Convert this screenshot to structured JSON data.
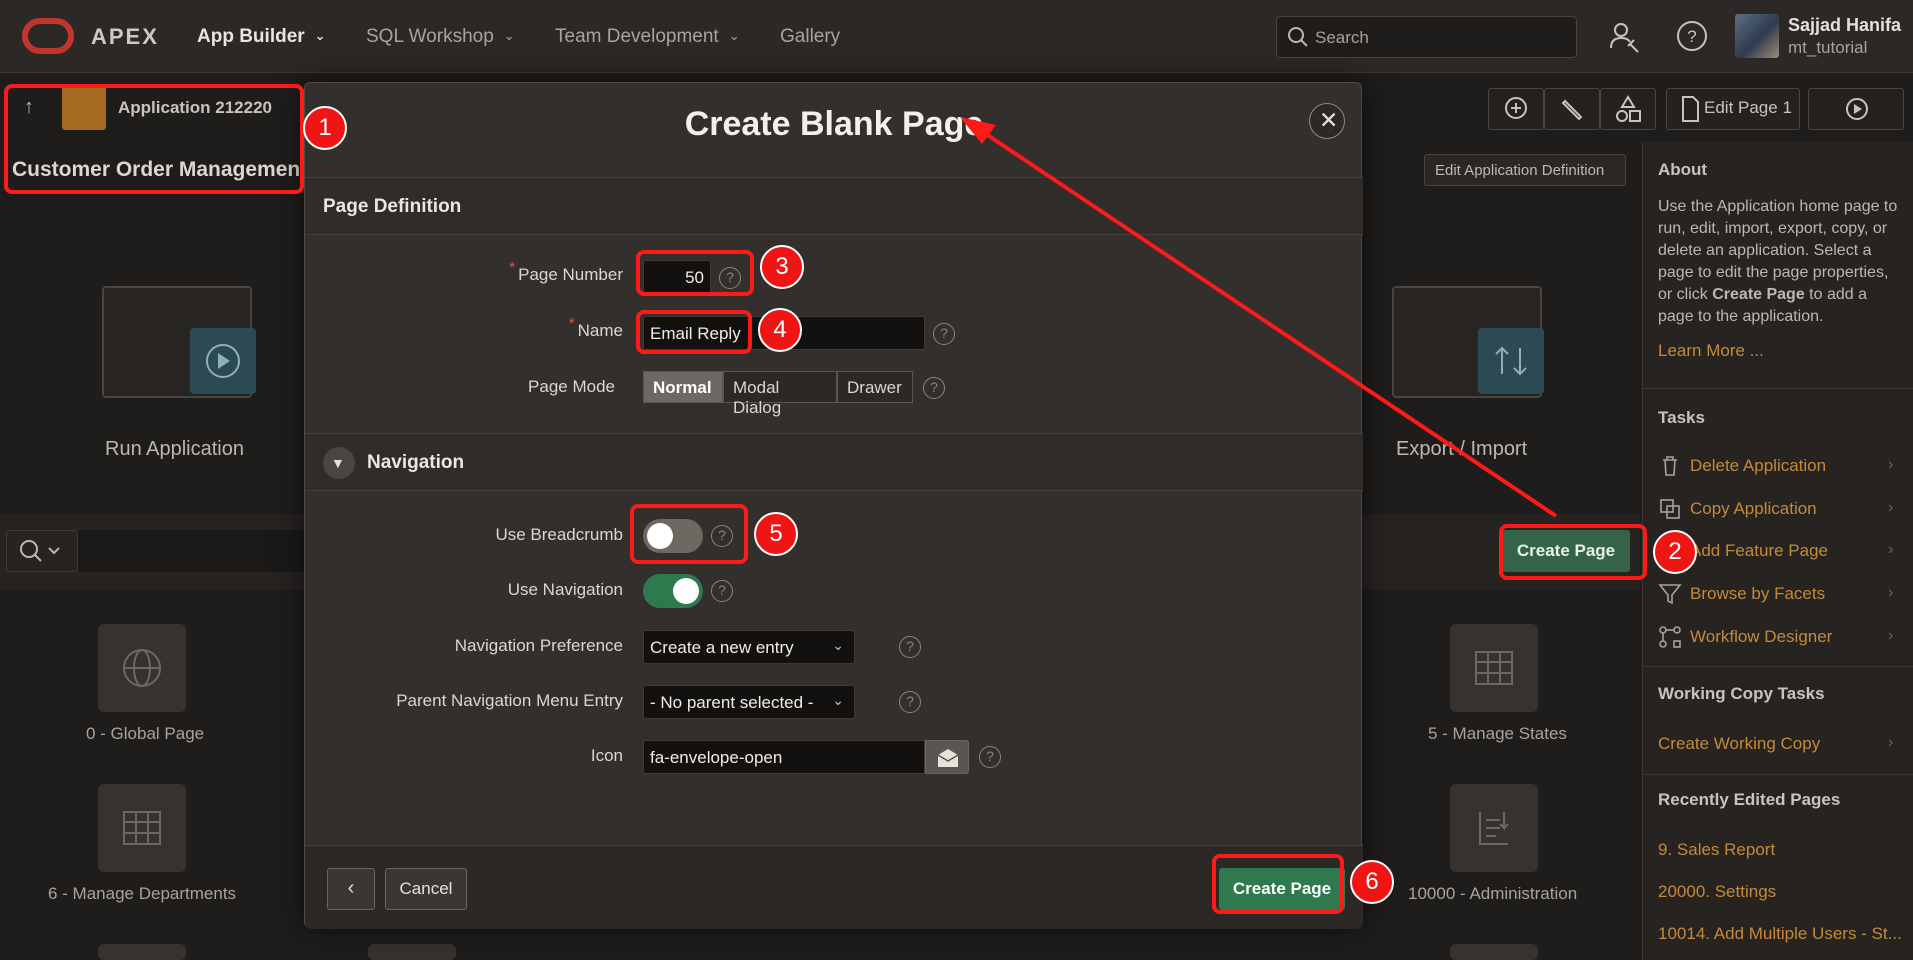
{
  "topnav": {
    "brand": "APEX",
    "items": [
      {
        "label": "App Builder"
      },
      {
        "label": "SQL Workshop"
      },
      {
        "label": "Team Development"
      },
      {
        "label": "Gallery"
      }
    ],
    "search_placeholder": "Search",
    "user_name": "Sajjad Hanifa",
    "user_login": "mt_tutorial"
  },
  "app": {
    "name": "Application 212220",
    "title": "Customer Order Management"
  },
  "toolbar": {
    "edit_page": "Edit Page 1",
    "edit_app_def": "Edit Application Definition"
  },
  "bg": {
    "run_app": "Run Application",
    "export_import": "Export / Import",
    "create_page": "Create Page",
    "pages": [
      {
        "label": "0 - Global Page"
      },
      {
        "label": "5 - Manage States"
      },
      {
        "label": "6 - Manage Departments"
      },
      {
        "label": "10000 - Administration"
      }
    ]
  },
  "sidebar": {
    "about_title": "About",
    "about_text_a": "Use the Application home page to run, edit, import, export, copy, or delete an application. Select a page to edit the page properties, or click ",
    "about_text_b": "Create Page",
    "about_text_c": " to add a page to the application.",
    "learn_more": "Learn More ...",
    "tasks_title": "Tasks",
    "tasks": [
      {
        "label": "Delete Application",
        "icon": "trash-icon"
      },
      {
        "label": "Copy Application",
        "icon": "copy-icon"
      },
      {
        "label": "Add Feature Page",
        "icon": "feature-icon"
      },
      {
        "label": "Browse by Facets",
        "icon": "filter-icon"
      },
      {
        "label": "Workflow Designer",
        "icon": "workflow-icon"
      }
    ],
    "working_copy_title": "Working Copy Tasks",
    "create_working_copy": "Create Working Copy",
    "recent_title": "Recently Edited Pages",
    "recent": [
      {
        "label": "9. Sales Report"
      },
      {
        "label": "20000. Settings"
      },
      {
        "label": "10014. Add Multiple Users - St..."
      }
    ]
  },
  "modal": {
    "title": "Create Blank Page",
    "section_page_def": "Page Definition",
    "page_number_label": "Page Number",
    "page_number_value": "50",
    "name_label": "Name",
    "name_value": "Email Reply",
    "page_mode_label": "Page Mode",
    "page_modes": [
      "Normal",
      "Modal Dialog",
      "Drawer"
    ],
    "page_mode_selected": "Normal",
    "section_navigation": "Navigation",
    "use_breadcrumb_label": "Use Breadcrumb",
    "use_breadcrumb_on": false,
    "use_navigation_label": "Use Navigation",
    "use_navigation_on": true,
    "nav_pref_label": "Navigation Preference",
    "nav_pref_value": "Create a new entry",
    "parent_nav_label": "Parent Navigation Menu Entry",
    "parent_nav_value": "- No parent selected -",
    "icon_label": "Icon",
    "icon_value": "fa-envelope-open",
    "cancel": "Cancel",
    "create": "Create Page",
    "required_mark": "*",
    "help_mark": "?"
  },
  "annotations": [
    "1",
    "2",
    "3",
    "4",
    "5",
    "6"
  ],
  "colors": {
    "annotation": "#ff1a1a",
    "primary_button": "#2e7a4e",
    "link": "#c48a3a"
  }
}
